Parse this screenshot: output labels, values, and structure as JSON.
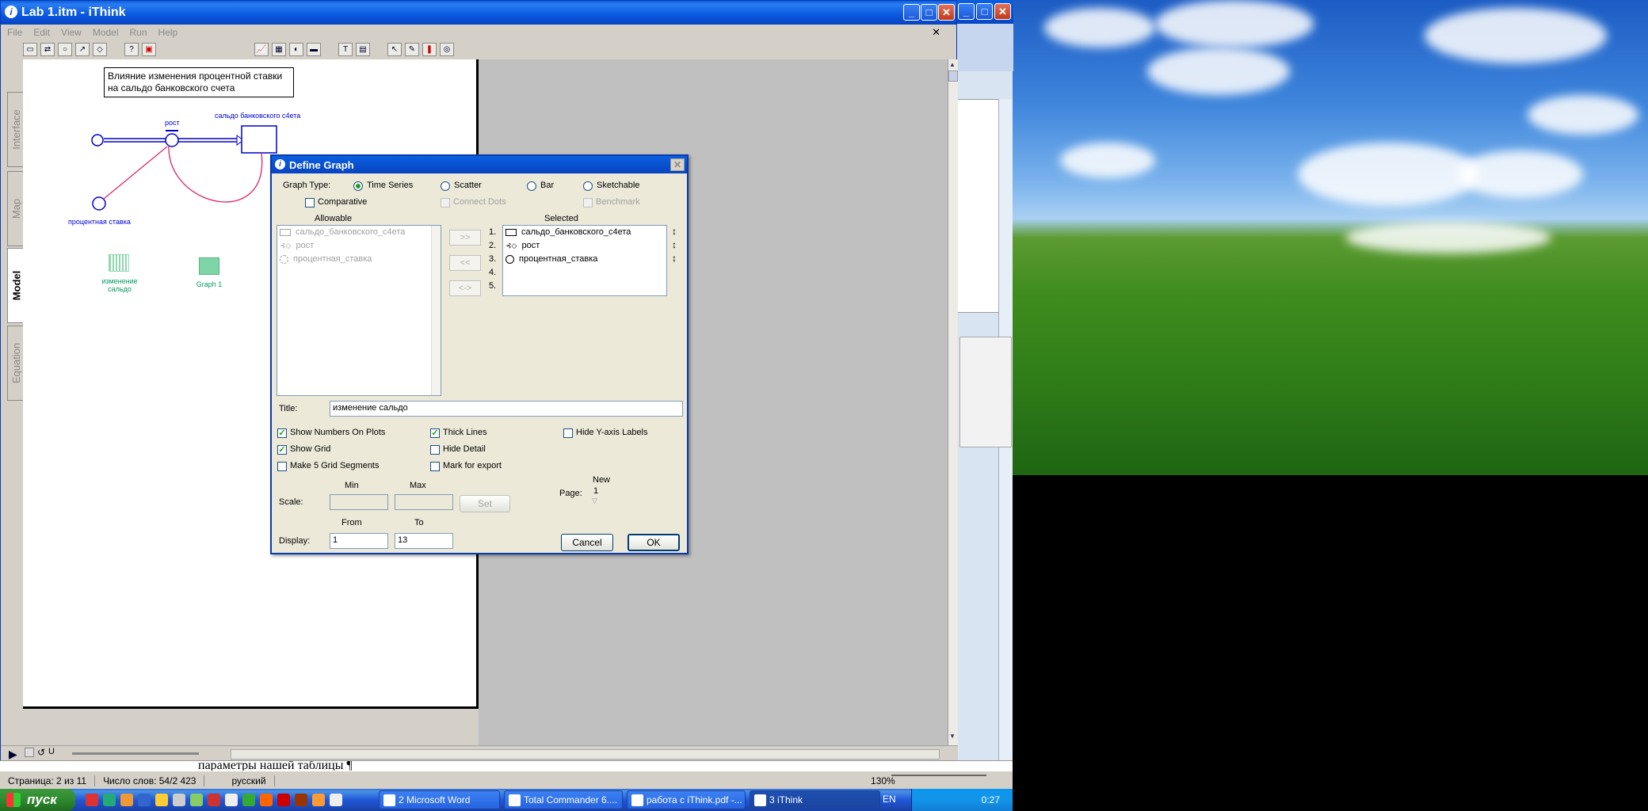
{
  "app": {
    "title": "Lab 1.itm - iThink"
  },
  "menu": [
    "File",
    "Edit",
    "View",
    "Model",
    "Run",
    "Help"
  ],
  "tabs": [
    "Interface",
    "Map",
    "Model",
    "Equation"
  ],
  "model": {
    "note_line1": "Влияние изменения процентной ставки",
    "note_line2": "на сальдо банковского счета",
    "stock_label": "сальдо банковского с4ета",
    "flow_label": "рост",
    "converter_label": "процентная ставка",
    "graph_icon_label_1": "изменение",
    "graph_icon_label_2": "сальдо",
    "graph1_label": "Graph 1"
  },
  "dialog": {
    "title": "Define Graph",
    "graph_type_label": "Graph Type:",
    "types": {
      "time_series": "Time Series",
      "scatter": "Scatter",
      "bar": "Bar",
      "sketchable": "Sketchable"
    },
    "comparative": "Comparative",
    "connect_dots": "Connect Dots",
    "benchmark": "Benchmark",
    "allowable_header": "Allowable",
    "selected_header": "Selected",
    "allowable": [
      "сальдо_банковского_с4ета",
      "рост",
      "процентная_ставка"
    ],
    "move_right": ">>",
    "move_left": "<<",
    "swap": "<->",
    "selected_numbers": [
      "1.",
      "2.",
      "3.",
      "4.",
      "5."
    ],
    "selected": [
      "сальдо_банковского_с4ета",
      "рост",
      "процентная_ставка"
    ],
    "title_label": "Title:",
    "title_value": "изменение сальдо",
    "show_numbers": "Show Numbers On Plots",
    "show_grid": "Show Grid",
    "make5": "Make 5 Grid Segments",
    "thick_lines": "Thick Lines",
    "hide_detail": "Hide Detail",
    "mark_export": "Mark for export",
    "hide_y": "Hide Y-axis Labels",
    "min_label": "Min",
    "max_label": "Max",
    "scale_label": "Scale:",
    "set_button": "Set",
    "page_label": "Page:",
    "page_new": "New",
    "page_value": "1",
    "from_label": "From",
    "to_label": "To",
    "display_label": "Display:",
    "from_value": "1",
    "to_value": "13",
    "cancel": "Cancel",
    "ok": "OK"
  },
  "word_strip_text": "параметры нашей таблицы ¶",
  "status": {
    "page": "Страница: 2 из 11",
    "words": "Число слов: 54/2 423",
    "lang": "русский",
    "zoom": "130%"
  },
  "taskbar": {
    "start": "пуск",
    "tasks": [
      "2 Microsoft Word",
      "Total Commander 6....",
      "работа с iThink.pdf -...",
      "3 iThink"
    ],
    "lang": "EN",
    "clock": "0:27"
  },
  "colors": {
    "accent": "#0a5fe0",
    "model_blue": "#0000cc",
    "connector": "#e0206a",
    "graph_green": "#009a60"
  }
}
